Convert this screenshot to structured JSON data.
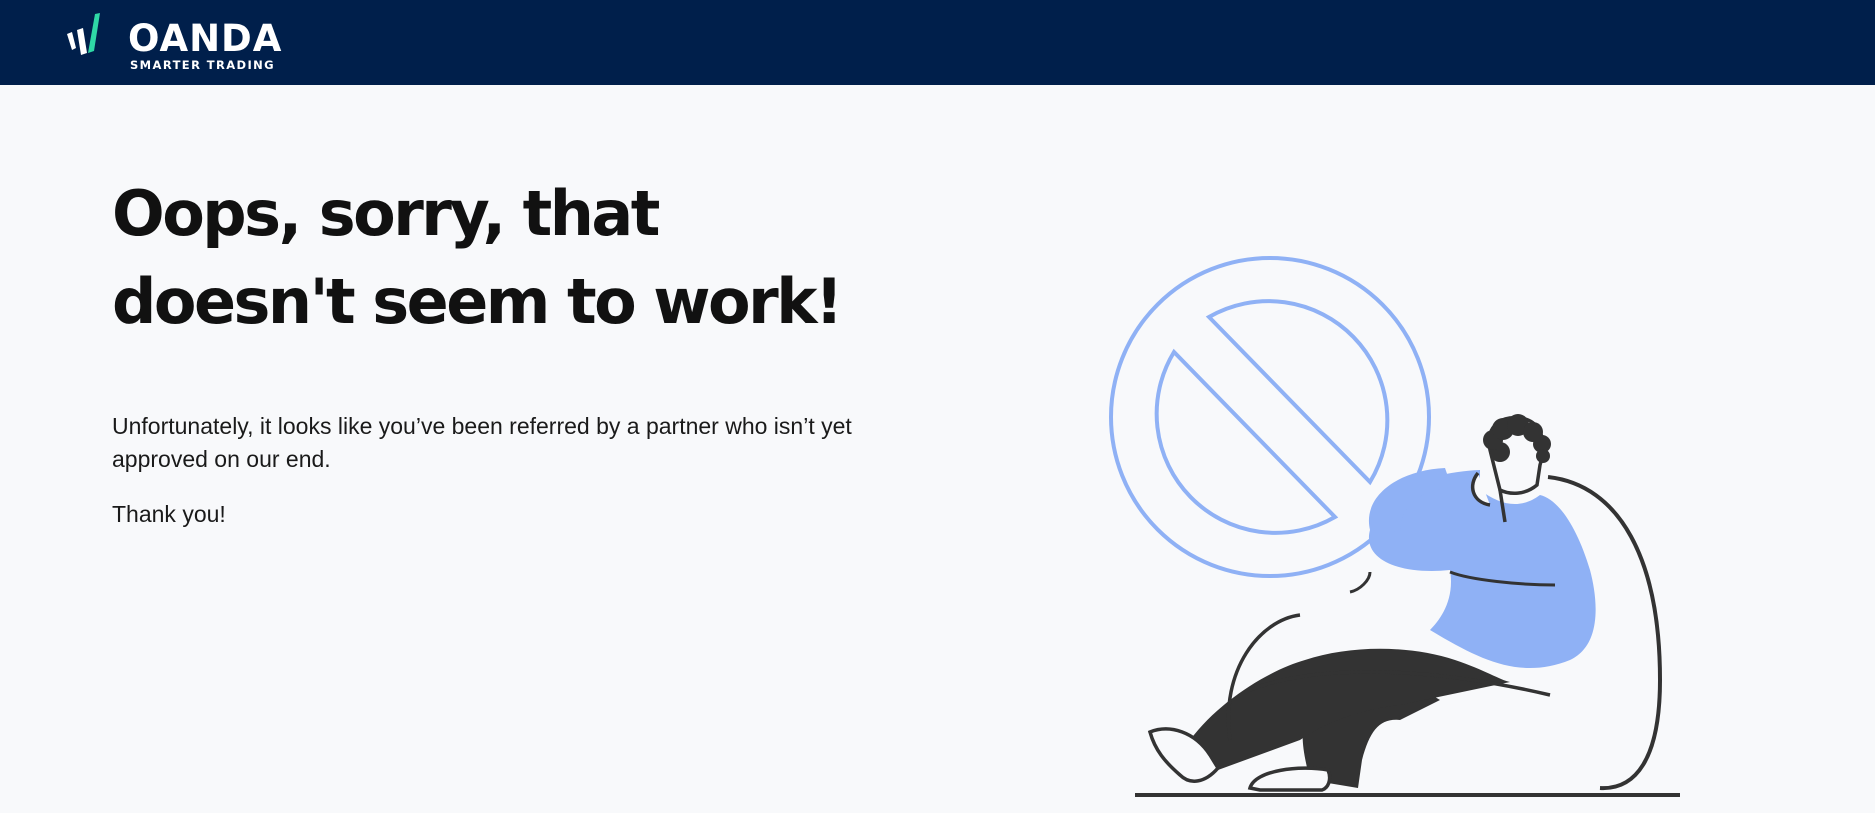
{
  "header": {
    "brand_name": "OANDA",
    "brand_tagline": "SMARTER TRADING",
    "colors": {
      "background": "#001f4b",
      "logo_accent": "#2fd8a6",
      "text": "#ffffff"
    }
  },
  "main": {
    "headline_line1": "Oops, sorry, that",
    "headline_line2": "doesn't seem to work!",
    "message": "Unfortunately, it looks like you’ve been referred by a partner who isn’t yet approved on our end.",
    "thanks": "Thank you!"
  },
  "illustration": {
    "icon": "prohibited-sign-with-frustrated-person",
    "colors": {
      "accent": "#8fb1f5",
      "ink": "#333333"
    }
  }
}
